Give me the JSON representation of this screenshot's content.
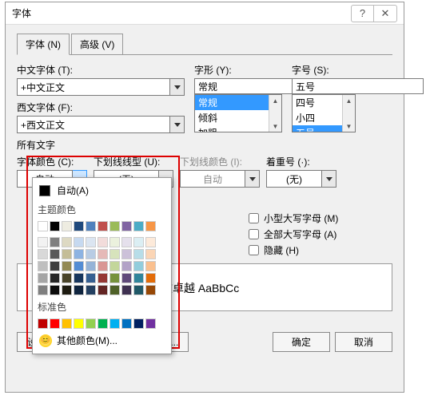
{
  "title": "字体",
  "title_buttons": {
    "help": "?",
    "close": "✕"
  },
  "tabs": {
    "font": "字体 (N)",
    "advanced": "高级 (V)"
  },
  "cn_font": {
    "label": "中文字体 (T):",
    "value": "+中文正文"
  },
  "west_font": {
    "label": "西文字体 (F):",
    "value": "+西文正文"
  },
  "style": {
    "label": "字形 (Y):",
    "value": "常规",
    "options": [
      "常规",
      "倾斜",
      "加粗"
    ]
  },
  "size": {
    "label": "字号 (S):",
    "value": "五号",
    "options": [
      "四号",
      "小四",
      "五号"
    ]
  },
  "all_text_label": "所有文字",
  "font_color": {
    "label": "字体颜色 (C):",
    "value": "自动"
  },
  "underline_style": {
    "label": "下划线线型 (U):",
    "value": "(无)"
  },
  "underline_color": {
    "label": "下划线颜色 (I):",
    "value": "自动"
  },
  "emphasis": {
    "label": "着重号 (·):",
    "value": "(无)"
  },
  "color_popup": {
    "auto": "自动(A)",
    "theme_label": "主题颜色",
    "theme_row1": [
      "#ffffff",
      "#000000",
      "#eeece1",
      "#1f497d",
      "#4f81bd",
      "#c0504d",
      "#9bbb59",
      "#8064a2",
      "#4bacc6",
      "#f79646"
    ],
    "theme_shades": [
      [
        "#f2f2f2",
        "#7f7f7f",
        "#ddd9c3",
        "#c6d9f0",
        "#dbe5f1",
        "#f2dcdb",
        "#ebf1dd",
        "#e5e0ec",
        "#dbeef3",
        "#fdeada"
      ],
      [
        "#d8d8d8",
        "#595959",
        "#c4bd97",
        "#8db3e2",
        "#b8cce4",
        "#e5b9b7",
        "#d7e3bc",
        "#ccc1d9",
        "#b7dde8",
        "#fbd5b5"
      ],
      [
        "#bfbfbf",
        "#3f3f3f",
        "#938953",
        "#548dd4",
        "#95b3d7",
        "#d99694",
        "#c3d69b",
        "#b2a2c7",
        "#92cddc",
        "#fac08f"
      ],
      [
        "#a5a5a5",
        "#262626",
        "#494429",
        "#17365d",
        "#366092",
        "#953734",
        "#76923c",
        "#5f497a",
        "#31859b",
        "#e36c09"
      ],
      [
        "#7f7f7f",
        "#0c0c0c",
        "#1d1b10",
        "#0f243e",
        "#244061",
        "#632423",
        "#4f6128",
        "#3f3151",
        "#205867",
        "#974806"
      ]
    ],
    "standard_label": "标准色",
    "standard": [
      "#c00000",
      "#ff0000",
      "#ffc000",
      "#ffff00",
      "#92d050",
      "#00b050",
      "#00b0f0",
      "#0070c0",
      "#002060",
      "#7030a0"
    ],
    "more": "其他颜色(M)..."
  },
  "effects": {
    "small_caps": "小型大写字母 (M)",
    "all_caps": "全部大写字母 (A)",
    "hidden": "隐藏 (H)"
  },
  "preview_text": "文卓越 AaBbCc",
  "footer": {
    "set_default": "设为默认值 (D)",
    "text_effects": "文字效果 (E)...",
    "ok": "确定",
    "cancel": "取消"
  }
}
